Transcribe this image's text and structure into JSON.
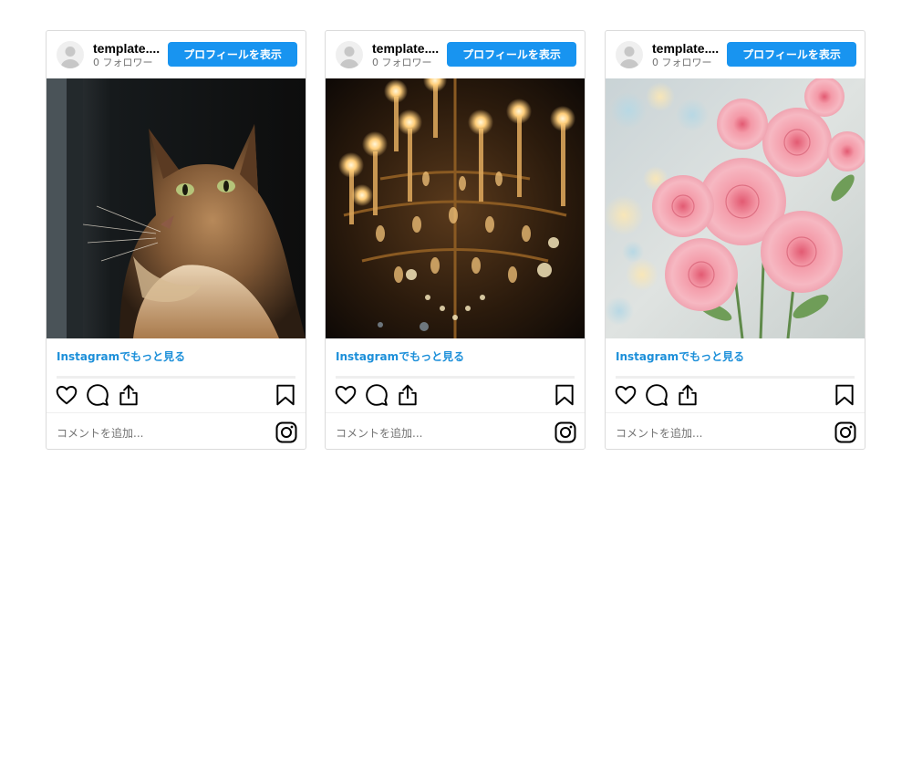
{
  "posts": [
    {
      "username": "template....",
      "followers": "0 フォロワー",
      "view_profile_label": "プロフィールを表示",
      "image_subject": "cat",
      "more_link": "Instagramでもっと見る",
      "comment_placeholder": "コメントを追加..."
    },
    {
      "username": "template....",
      "followers": "0 フォロワー",
      "view_profile_label": "プロフィールを表示",
      "image_subject": "chandelier",
      "more_link": "Instagramでもっと見る",
      "comment_placeholder": "コメントを追加..."
    },
    {
      "username": "template....",
      "followers": "0 フォロワー",
      "view_profile_label": "プロフィールを表示",
      "image_subject": "pink-roses",
      "more_link": "Instagramでもっと見る",
      "comment_placeholder": "コメントを追加..."
    }
  ],
  "icons": [
    "avatar-placeholder-icon",
    "heart-icon",
    "comment-icon",
    "share-icon",
    "bookmark-icon",
    "instagram-logo-icon"
  ],
  "colors": {
    "button": "#1894f0",
    "link": "#1c8fd9",
    "border": "#dbdbdb",
    "muted": "#737373"
  }
}
